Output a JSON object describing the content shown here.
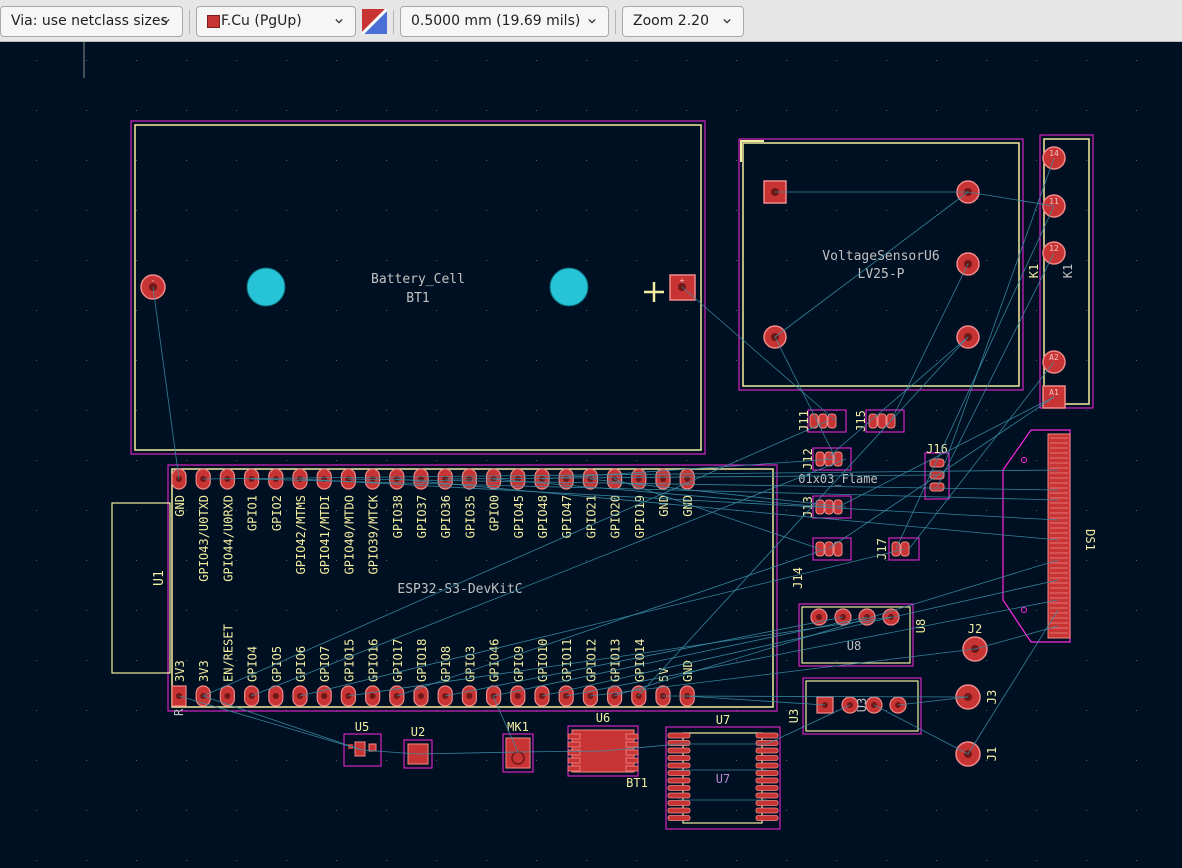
{
  "toolbar": {
    "via_size": "Via: use netclass sizes",
    "layer": "F.Cu (PgUp)",
    "grid": "0.5000 mm (19.69 mils)",
    "zoom": "Zoom 2.20"
  },
  "colors": {
    "canvas": "#001023",
    "pad": "#c83434",
    "pad_outline": "#f08a8a",
    "courtyard": "#ff26e2",
    "silkscreen": "#f2eda1",
    "ratsnest": "#3a8fa6",
    "drill": "#27c3d6",
    "fab_text": "#c2c2c2"
  },
  "board": {
    "bt1_ref": "BT1",
    "bt1_value": "Battery_Cell",
    "bt1_pad_minus": "-",
    "bt1_pad_plus": "+",
    "u6_value": "VoltageSensorU6",
    "u6_part": "LV25-P",
    "k1_ref": "K1",
    "k1_fab": "K1",
    "k1_pads": [
      "14",
      "11",
      "12",
      "A2",
      "A1"
    ],
    "u1_ref": "U1",
    "u1_value": "ESP32-S3-DevKitC",
    "u1_top_pins": [
      "GND",
      "GPIO43/U0TXD",
      "GPIO44/U0RXD",
      "GPIO1",
      "GPIO2",
      "GPIO42/MTMS",
      "GPIO41/MTDI",
      "GPIO40/MTDO",
      "GPIO39/MTCK",
      "GPIO38",
      "GPIO37",
      "GPIO36",
      "GPIO35",
      "GPIO0",
      "GPIO45",
      "GPIO48",
      "GPIO47",
      "GPIO21",
      "GPIO20",
      "GPIO19",
      "GND",
      "GND"
    ],
    "u1_bottom_pins": [
      "3V3",
      "3V3",
      "EN/RESET",
      "GPIO4",
      "GPIO5",
      "GPIO6",
      "GPIO7",
      "GPIO15",
      "GPIO16",
      "GPIO17",
      "GPIO18",
      "GPIO8",
      "GPIO3",
      "GPIO46",
      "GPIO9",
      "GPIO10",
      "GPIO11",
      "GPIO12",
      "GPIO13",
      "GPIO14",
      "5V",
      "GND"
    ],
    "u1_r_fragment": "R",
    "j11": "J11",
    "j15": "J15",
    "j12": "J12",
    "j12_value": "01x03_Flame",
    "j16": "J16",
    "j13": "J13",
    "j14": "J14",
    "j17": "J17",
    "ds1": "DS1",
    "u8_ref": "U8",
    "u8_fab": "U8",
    "j2": "J2",
    "j3": "J3",
    "j1": "J1",
    "u3_ref": "U3",
    "u3_fab": "U3",
    "u5": "U5",
    "u2": "U2",
    "mk1": "MK1",
    "u6_small": "U6",
    "bt1_small": "BT1",
    "u7_ref": "U7",
    "u7_fab": "U7"
  }
}
